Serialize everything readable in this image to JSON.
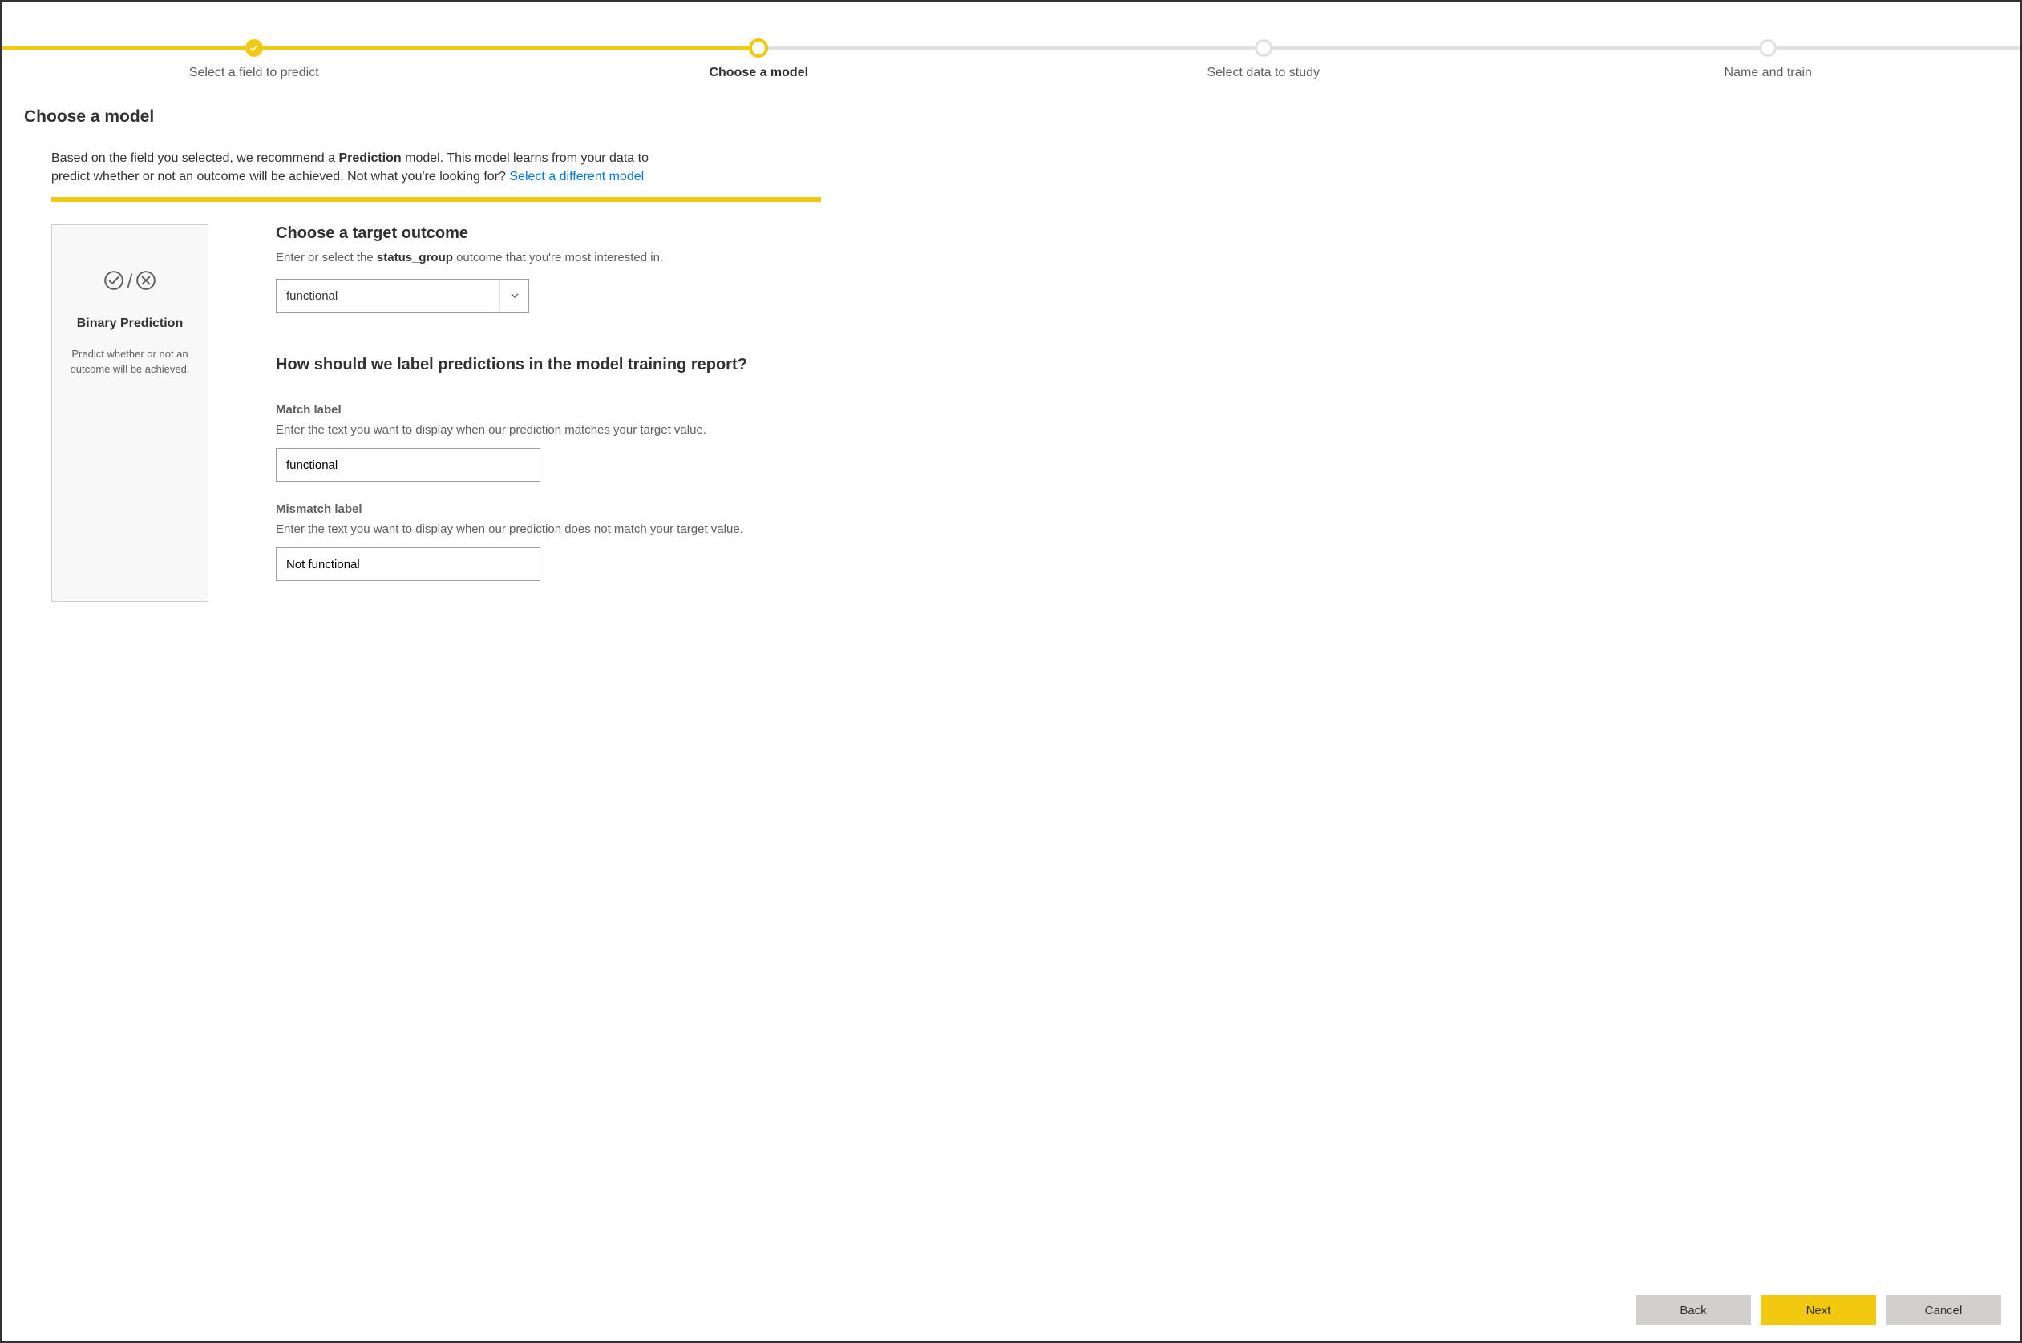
{
  "stepper": {
    "steps": [
      {
        "label": "Select a field to predict",
        "state": "done"
      },
      {
        "label": "Choose a model",
        "state": "current"
      },
      {
        "label": "Select data to study",
        "state": "pending"
      },
      {
        "label": "Name and train",
        "state": "pending"
      }
    ]
  },
  "page_title": "Choose a model",
  "intro": {
    "prefix": "Based on the field you selected, we recommend a ",
    "bold": "Prediction",
    "suffix": " model. This model learns from your data to predict whether or not an outcome will be achieved. Not what you're looking for? ",
    "link_text": "Select a different model"
  },
  "model_card": {
    "title": "Binary Prediction",
    "desc": "Predict whether or not an outcome will be achieved."
  },
  "target_outcome": {
    "heading": "Choose a target outcome",
    "sub_prefix": "Enter or select the ",
    "sub_bold": "status_group",
    "sub_suffix": " outcome that you're most interested in.",
    "value": "functional"
  },
  "labels_section": {
    "heading": "How should we label predictions in the model training report?",
    "match": {
      "label": "Match label",
      "help": "Enter the text you want to display when our prediction matches your target value.",
      "value": "functional"
    },
    "mismatch": {
      "label": "Mismatch label",
      "help": "Enter the text you want to display when our prediction does not match your target value.",
      "value": "Not functional"
    }
  },
  "footer": {
    "back": "Back",
    "next": "Next",
    "cancel": "Cancel"
  }
}
